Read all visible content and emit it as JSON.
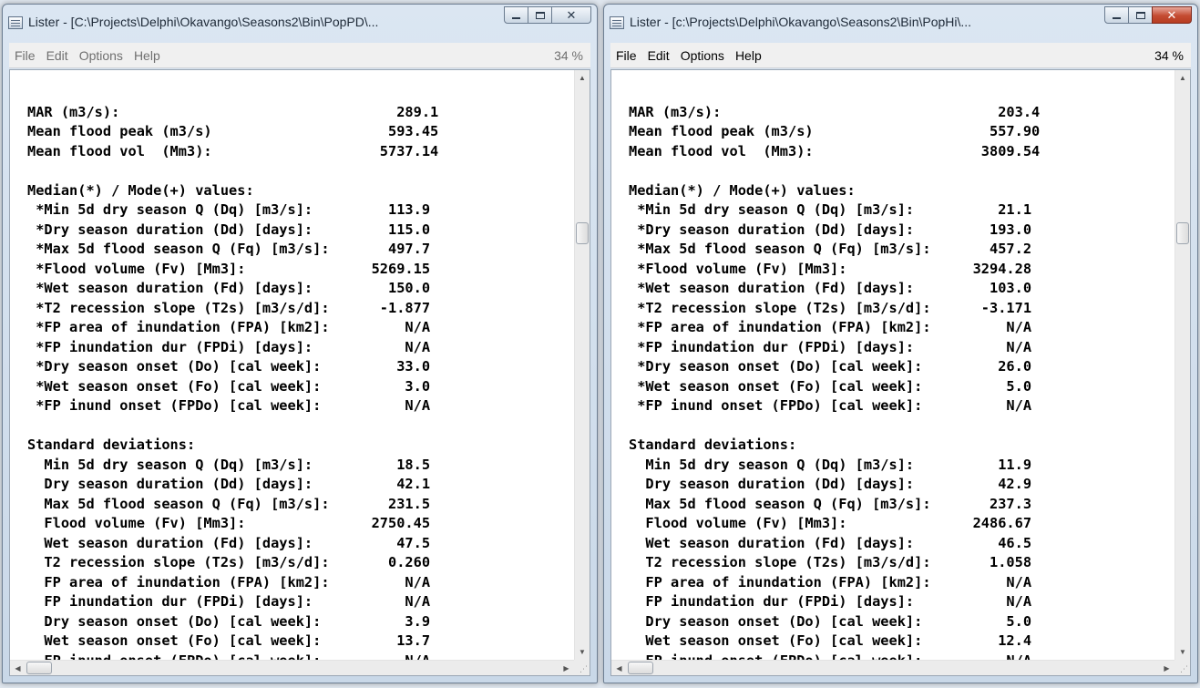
{
  "windows": [
    {
      "title": "Lister - [C:\\Projects\\Delphi\\Okavango\\Seasons2\\Bin\\PopPD\\...",
      "menu": [
        "File",
        "Edit",
        "Options",
        "Help"
      ],
      "zoom": "34 %",
      "lines": [
        "",
        "MAR (m3/s):                                 289.1",
        "Mean flood peak (m3/s)                     593.45",
        "Mean flood vol  (Mm3):                    5737.14",
        "",
        "Median(*) / Mode(+) values:",
        " *Min 5d dry season Q (Dq) [m3/s]:         113.9",
        " *Dry season duration (Dd) [days]:         115.0",
        " *Max 5d flood season Q (Fq) [m3/s]:       497.7",
        " *Flood volume (Fv) [Mm3]:               5269.15",
        " *Wet season duration (Fd) [days]:         150.0",
        " *T2 recession slope (T2s) [m3/s/d]:      -1.877",
        " *FP area of inundation (FPA) [km2]:         N/A",
        " *FP inundation dur (FPDi) [days]:           N/A",
        " *Dry season onset (Do) [cal week]:         33.0",
        " *Wet season onset (Fo) [cal week]:          3.0",
        " *FP inund onset (FPDo) [cal week]:          N/A",
        "",
        "Standard deviations:",
        "  Min 5d dry season Q (Dq) [m3/s]:          18.5",
        "  Dry season duration (Dd) [days]:          42.1",
        "  Max 5d flood season Q (Fq) [m3/s]:       231.5",
        "  Flood volume (Fv) [Mm3]:               2750.45",
        "  Wet season duration (Fd) [days]:          47.5",
        "  T2 recession slope (T2s) [m3/s/d]:       0.260",
        "  FP area of inundation (FPA) [km2]:         N/A",
        "  FP inundation dur (FPDi) [days]:           N/A",
        "  Dry season onset (Do) [cal week]:          3.9",
        "  Wet season onset (Fo) [cal week]:         13.7",
        "  FP inund onset (FPDo) [cal week]:          N/A"
      ]
    },
    {
      "title": "Lister - [c:\\Projects\\Delphi\\Okavango\\Seasons2\\Bin\\PopHi\\...",
      "menu": [
        "File",
        "Edit",
        "Options",
        "Help"
      ],
      "zoom": "34 %",
      "lines": [
        "",
        "MAR (m3/s):                                 203.4",
        "Mean flood peak (m3/s)                     557.90",
        "Mean flood vol  (Mm3):                    3809.54",
        "",
        "Median(*) / Mode(+) values:",
        " *Min 5d dry season Q (Dq) [m3/s]:          21.1",
        " *Dry season duration (Dd) [days]:         193.0",
        " *Max 5d flood season Q (Fq) [m3/s]:       457.2",
        " *Flood volume (Fv) [Mm3]:               3294.28",
        " *Wet season duration (Fd) [days]:         103.0",
        " *T2 recession slope (T2s) [m3/s/d]:      -3.171",
        " *FP area of inundation (FPA) [km2]:         N/A",
        " *FP inundation dur (FPDi) [days]:           N/A",
        " *Dry season onset (Do) [cal week]:         26.0",
        " *Wet season onset (Fo) [cal week]:          5.0",
        " *FP inund onset (FPDo) [cal week]:          N/A",
        "",
        "Standard deviations:",
        "  Min 5d dry season Q (Dq) [m3/s]:          11.9",
        "  Dry season duration (Dd) [days]:          42.9",
        "  Max 5d flood season Q (Fq) [m3/s]:       237.3",
        "  Flood volume (Fv) [Mm3]:               2486.67",
        "  Wet season duration (Fd) [days]:          46.5",
        "  T2 recession slope (T2s) [m3/s/d]:       1.058",
        "  FP area of inundation (FPA) [km2]:         N/A",
        "  FP inundation dur (FPDi) [days]:           N/A",
        "  Dry season onset (Do) [cal week]:          5.0",
        "  Wet season onset (Fo) [cal week]:         12.4",
        "  FP inund onset (FPDo) [cal week]:          N/A"
      ]
    }
  ]
}
